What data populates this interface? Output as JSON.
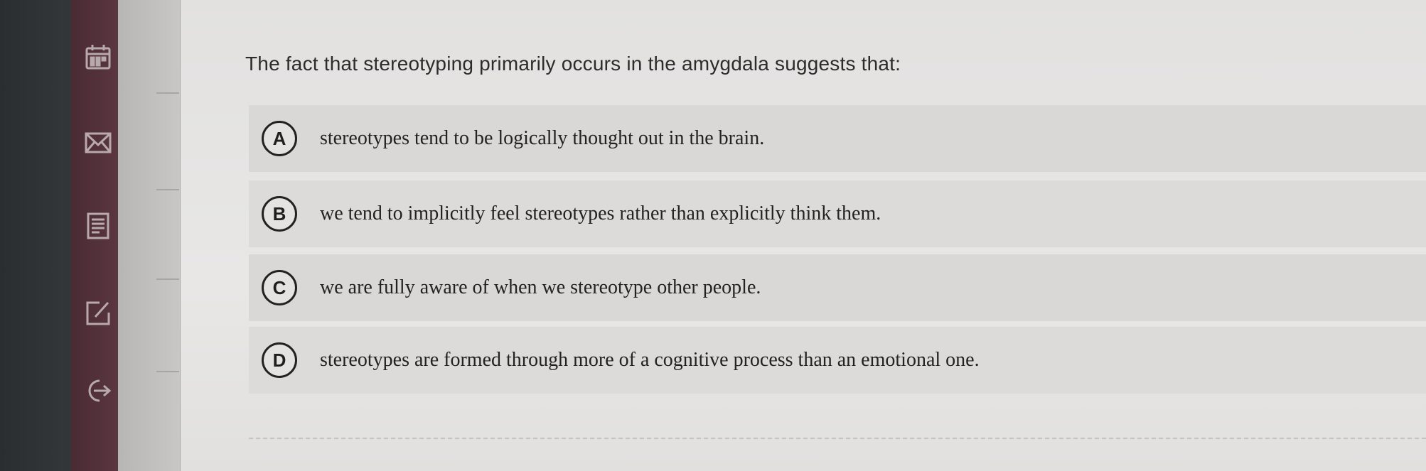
{
  "question": {
    "text": "The fact that stereotyping primarily occurs in the amygdala suggests that:"
  },
  "options": [
    {
      "letter": "A",
      "text": "stereotypes tend to be logically thought out in the brain."
    },
    {
      "letter": "B",
      "text": "we tend to implicitly feel stereotypes rather than explicitly think them."
    },
    {
      "letter": "C",
      "text": "we are fully aware of when we stereotype other people."
    },
    {
      "letter": "D",
      "text": "stereotypes are formed through more of a cognitive process than an emotional one."
    }
  ],
  "sidebar": {
    "icons": [
      "calendar-icon",
      "mail-icon",
      "document-icon",
      "edit-icon",
      "logout-icon"
    ]
  },
  "colors": {
    "sidebar": "#5a3640",
    "dark_edge": "#2f3336",
    "content_bg": "#e6e5e4",
    "text": "#222222"
  }
}
